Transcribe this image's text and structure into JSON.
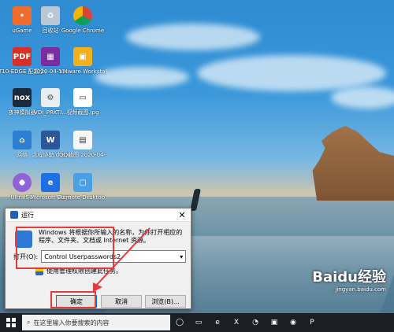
{
  "desktop": {
    "icons": [
      {
        "label": "uGame",
        "name": "ugame"
      },
      {
        "label": "回收站",
        "name": "recycle-bin"
      },
      {
        "label": "Google\nChrome",
        "name": "google-chrome"
      },
      {
        "label": "T10-EDGE\n配置手册",
        "name": "pdf-file"
      },
      {
        "label": "2020-04-1...",
        "name": "archive-file"
      },
      {
        "label": "VMware\nWorkstati...",
        "name": "vmware-workstation"
      },
      {
        "label": "夜神模拟器",
        "name": "nox-player"
      },
      {
        "label": "VDI_PRKTI...",
        "name": "vdi-file"
      },
      {
        "label": "视频截图.jpg",
        "name": "jpg-file"
      },
      {
        "label": "网络",
        "name": "network"
      },
      {
        "label": "远程协助.docx",
        "name": "word-file"
      },
      {
        "label": "QQ截图\n2020-04-1...",
        "name": "qq-screenshot"
      },
      {
        "label": "UltraISO",
        "name": "ultraiso"
      },
      {
        "label": "Microsoft\nEdge",
        "name": "microsoft-edge"
      },
      {
        "label": "Remote\nDesktop...",
        "name": "remote-desktop"
      }
    ]
  },
  "run_dialog": {
    "title": "运行",
    "description": "Windows 将根据你所输入的名称，为你打开相应的程序、文件夹、文档或 Internet 资源。",
    "open_label": "打开(O):",
    "open_value": "Control Userpasswords2",
    "admin_text": "使用管理权限创建此任务。",
    "buttons": {
      "ok": "确定",
      "cancel": "取消",
      "browse": "浏览(B)..."
    }
  },
  "taskbar": {
    "search_placeholder": "在这里输入你要搜索的内容"
  },
  "watermark": {
    "brand": "Baidu经验",
    "url": "jingyan.baidu.com"
  }
}
